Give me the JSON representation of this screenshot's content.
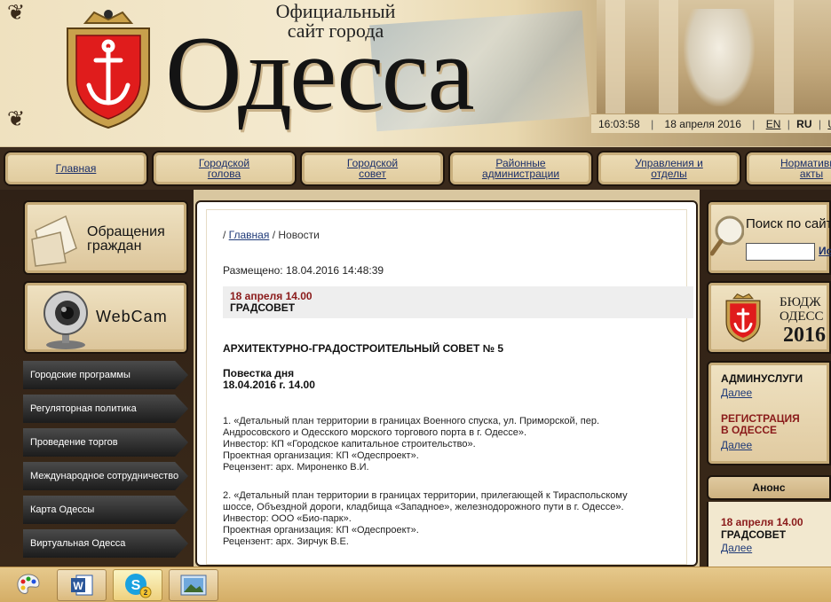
{
  "header": {
    "title_small": "Официальный сайт города",
    "title_big": "Одесса",
    "time": "16:03:58",
    "date": "18 апреля 2016",
    "lang_en": "EN",
    "lang_ru": "RU",
    "lang_ua": "U"
  },
  "topnav": {
    "items": [
      {
        "label": "Главная"
      },
      {
        "label": "Городской голова"
      },
      {
        "label": "Городской совет"
      },
      {
        "label": "Районные администрации"
      },
      {
        "label": "Управления и отделы"
      },
      {
        "label": "Нормативные акты"
      }
    ]
  },
  "leftcol": {
    "appeals_label": "Обращения граждан",
    "webcam_label": "WebCam",
    "menu": [
      {
        "label": "Городские программы"
      },
      {
        "label": "Регуляторная политика"
      },
      {
        "label": "Проведение торгов"
      },
      {
        "label": "Международное сотрудничество"
      },
      {
        "label": "Карта Одессы"
      },
      {
        "label": "Виртуальная Одесса"
      }
    ]
  },
  "main": {
    "breadcrumb_home": "Главная",
    "breadcrumb_current": "Новости",
    "placed": "Размещено: 18.04.2016 14:48:39",
    "news_date": "18 апреля 14.00",
    "news_title": "ГРАДСОВЕТ",
    "article_title": "АРХИТЕКТУРНО-ГРАДОСТРОИТЕЛЬНЫЙ СОВЕТ № 5",
    "agenda_label": "Повестка дня",
    "agenda_date": "18.04.2016 г. 14.00",
    "item1": [
      "1. «Детальный план территории в границах Военного спуска, ул. Приморской, пер.",
      "Андросовского и Одесского морского торгового порта в г. Одессе».",
      "Инвестор: КП «Городское капитальное строительство».",
      "Проектная организация: КП «Одеспроект».",
      "Рецензент: арх. Мироненко В.И."
    ],
    "item2": [
      "2. «Детальный план территории в границах территории, прилегающей к Тираспольскому",
      "шоссе, Объездной дороги, кладбища «Западное», железнодорожного пути в г. Одессе».",
      "Инвестор: ООО «Био-парк».",
      "Проектная организация: КП «Одеспроект».",
      "Рецензент: арх. Зирчук В.Е."
    ]
  },
  "rightcol": {
    "search_label": "Поиск по сайт",
    "search_value": "",
    "search_button": "Ис",
    "budget_line1": "БЮДЖ",
    "budget_line2": "ОДЕСС",
    "budget_year": "2016",
    "admin_label": "АДМИНУСЛУГИ",
    "admin_more": "Далее",
    "reg_label_1": "РЕГИСТРАЦИЯ",
    "reg_label_2": "В ОДЕССЕ",
    "reg_more": "Далее",
    "anons_title": "Анонс",
    "anons_date": "18 апреля 14.00",
    "anons_event": "ГРАДСОВЕТ",
    "anons_more": "Далее"
  },
  "taskbar": {
    "skype_badge": "2"
  }
}
